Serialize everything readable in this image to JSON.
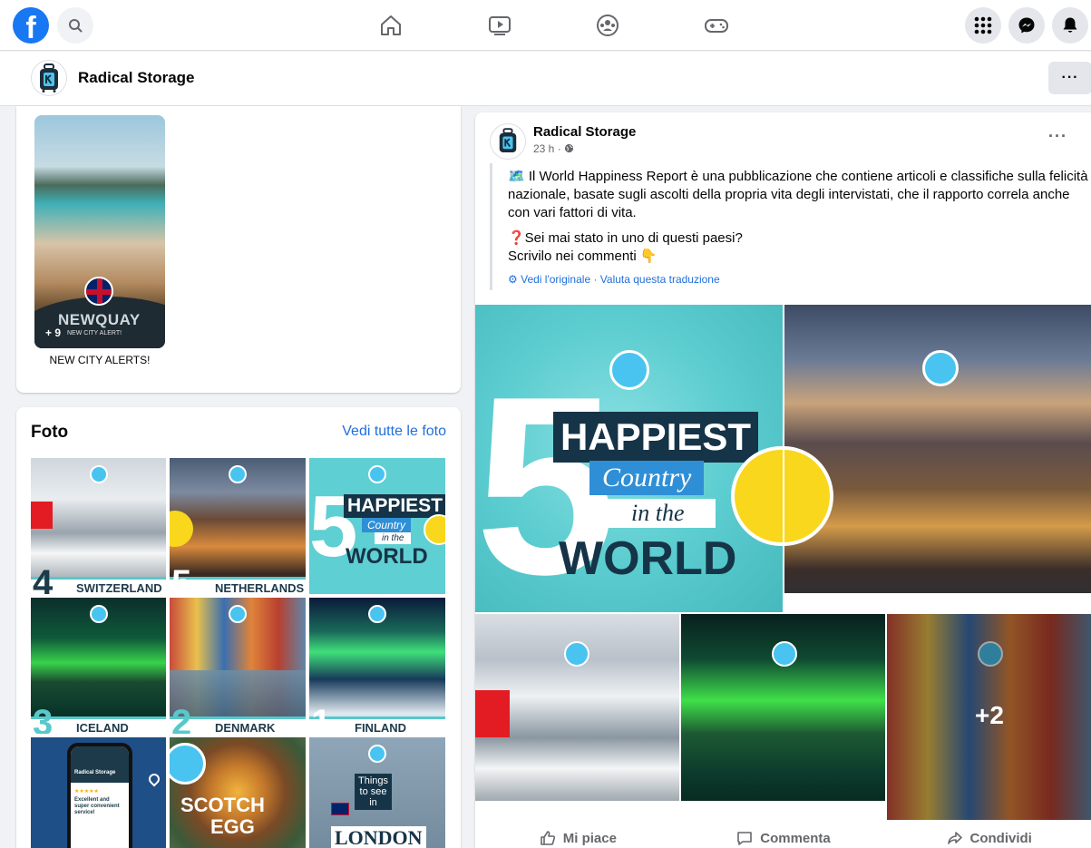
{
  "colors": {
    "brand": "#1877f2",
    "teal": "#58c8ca",
    "link": "#216fdb"
  },
  "topnav": {
    "logo_letter": "f",
    "icons": [
      "search-icon",
      "home-icon",
      "watch-icon",
      "groups-icon",
      "gaming-icon",
      "menu-grid-icon",
      "messenger-icon",
      "notifications-icon"
    ]
  },
  "page": {
    "name": "Radical Storage",
    "more_label": "···"
  },
  "story": {
    "city": "NEWQUAY",
    "plus": "+ 9",
    "tag": "NEW CITY ALERT!",
    "caption": "NEW CITY ALERTS!"
  },
  "photos": {
    "title": "Foto",
    "see_all": "Vedi tutte le foto",
    "tiles": [
      {
        "label": "SWITZERLAND",
        "num": "4"
      },
      {
        "label": "NETHERLANDS",
        "num": "5"
      },
      {
        "headline": "HAPPIEST",
        "sub1": "Country",
        "sub2": "in the",
        "sub3": "WORLD",
        "num": "5"
      },
      {
        "label": "ICELAND",
        "num": "3"
      },
      {
        "label": "DENMARK",
        "num": "2"
      },
      {
        "label": "FINLAND",
        "num": "1"
      },
      {
        "brand": "Radical Storage",
        "stars": "★★★★★",
        "review": "Excellent and super convenient service!"
      },
      {
        "line1": "SCOTCH",
        "line2": "EGG"
      },
      {
        "line1": "Things",
        "line2": "to see",
        "line3": "in",
        "line4": "LONDON"
      }
    ]
  },
  "post": {
    "author": "Radical Storage",
    "time": "23 h ·",
    "dots": "···",
    "paragraph1": "🗺️ Il World Happiness Report è una pubblicazione che contiene articoli e classifiche sulla felicità nazionale, basate sugli ascolti della propria vita degli intervistati, che il rapporto correla anche con vari fattori di vita.",
    "paragraph2a": "❓Sei mai stato in uno di questi paesi?",
    "paragraph2b": "Scrivilo nei commenti 👇",
    "translate": "Vedi l'originale · Valuta questa traduzione",
    "hero": {
      "headline": "HAPPIEST",
      "sub1": "Country",
      "sub2": "in the",
      "sub3": "WORLD",
      "num": "5"
    },
    "extra_count": "+2",
    "actions": {
      "like": "Mi piace",
      "comment": "Commenta",
      "share": "Condividi"
    }
  }
}
